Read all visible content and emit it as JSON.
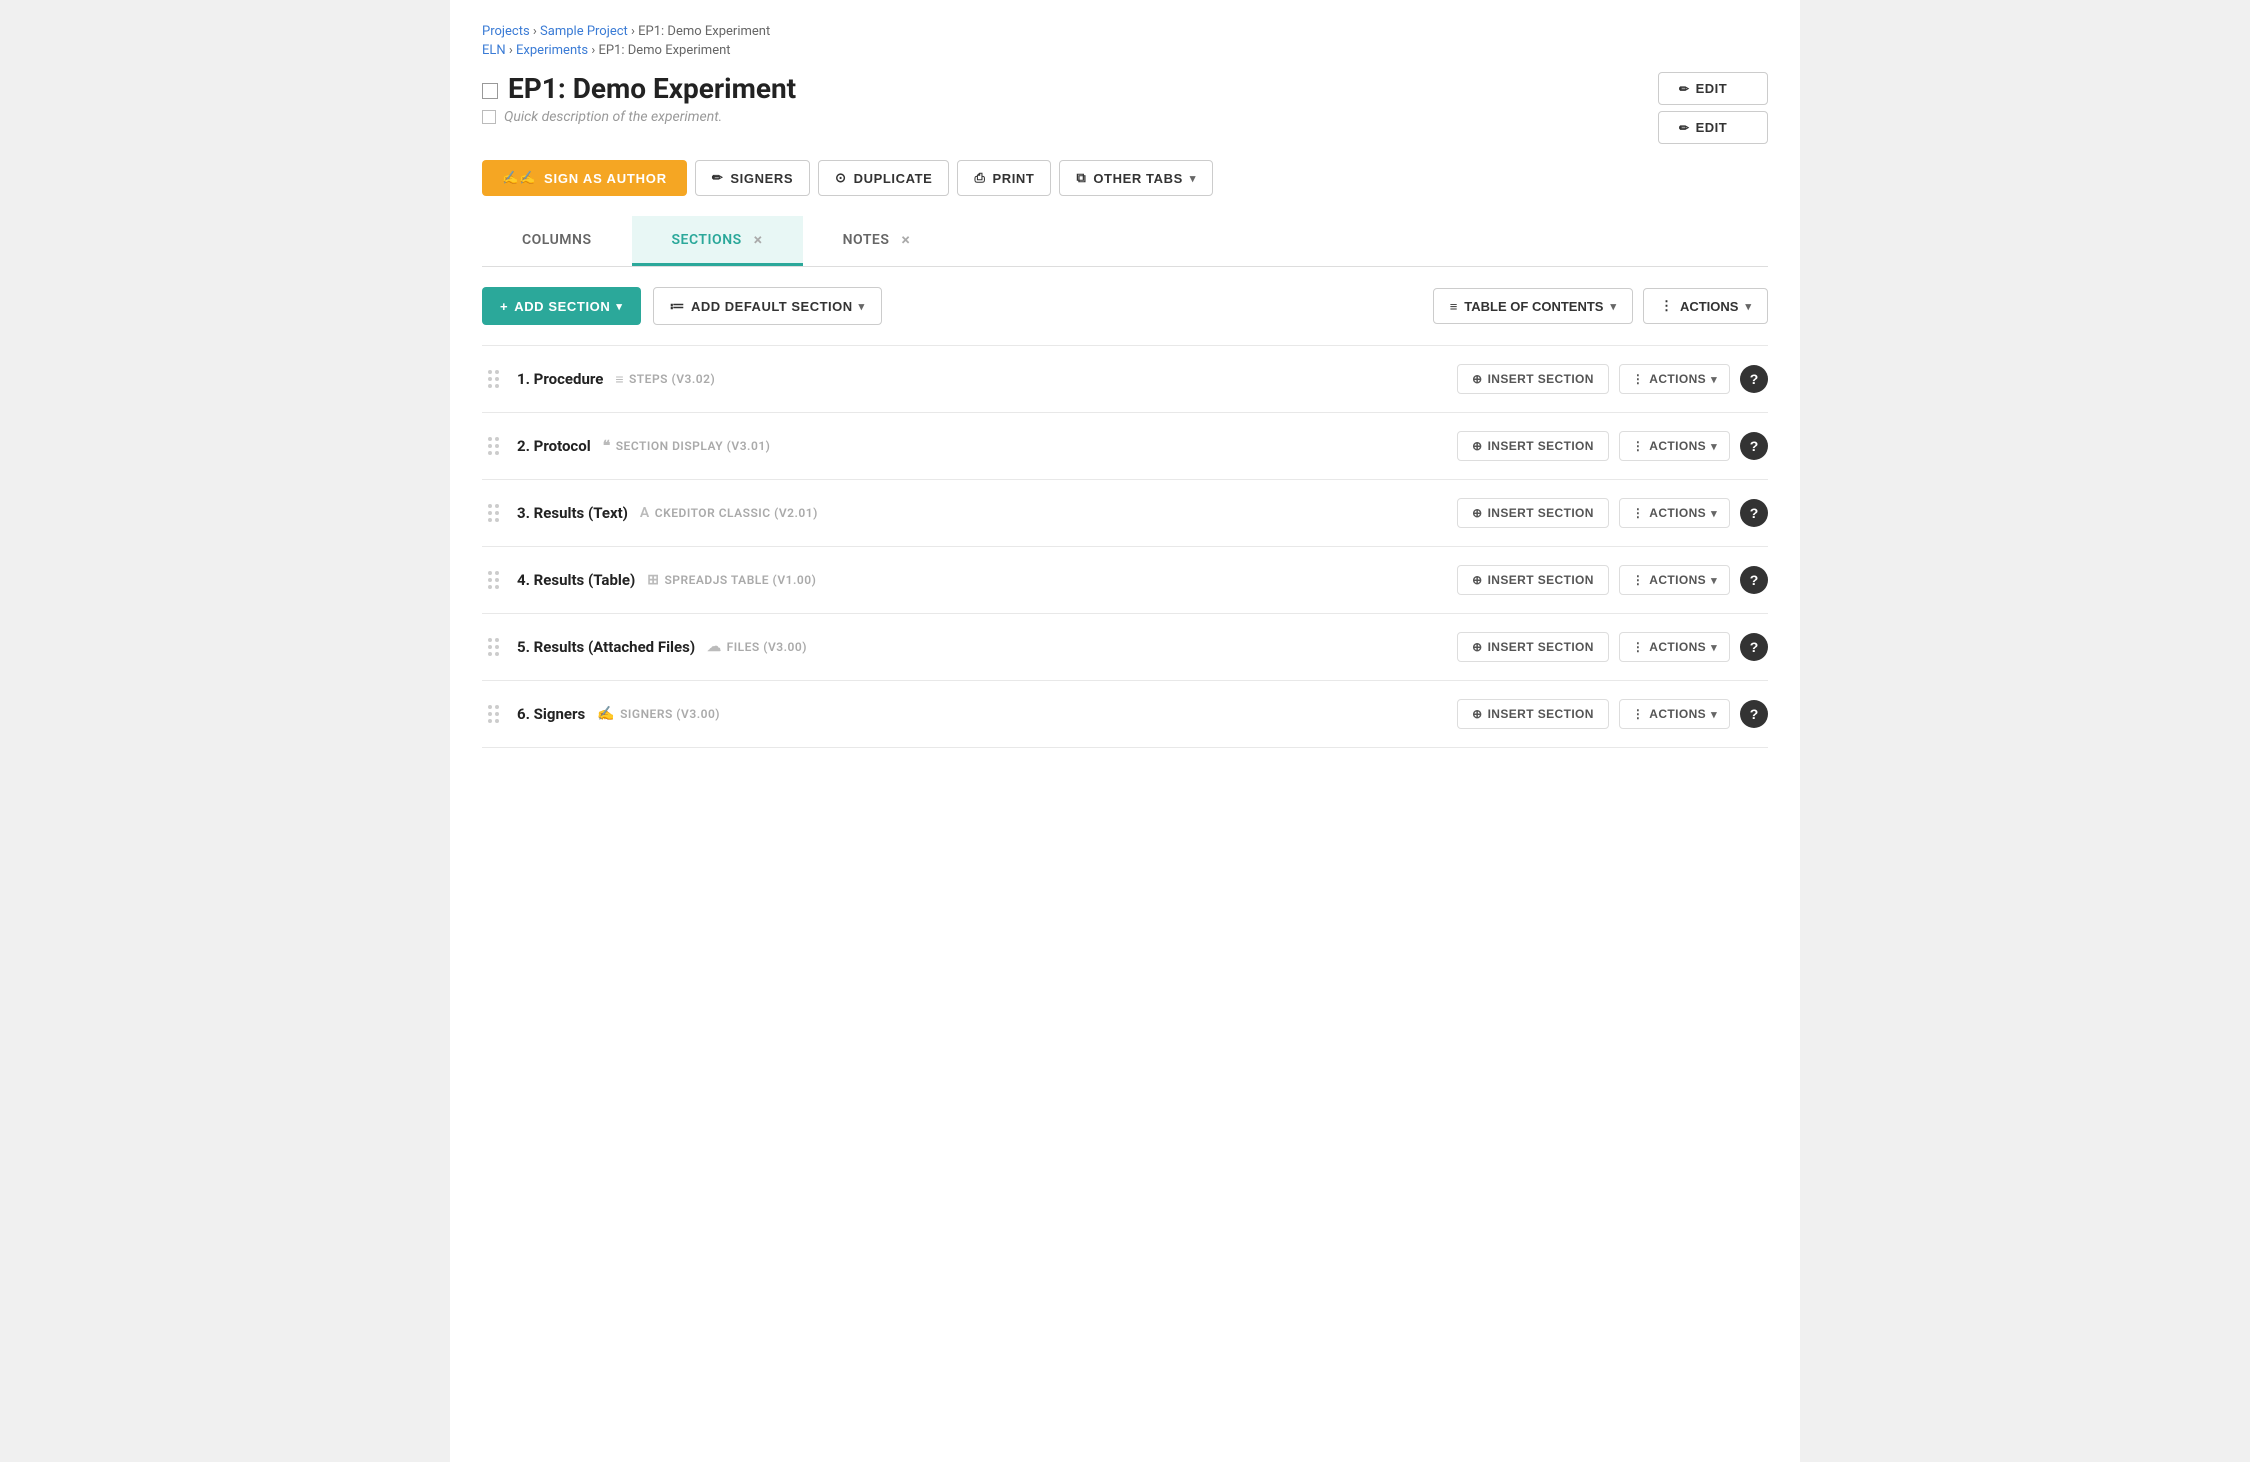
{
  "breadcrumbs": {
    "line1": [
      {
        "label": "Projects",
        "link": true
      },
      {
        "label": " › ",
        "link": false
      },
      {
        "label": "Sample Project",
        "link": true
      },
      {
        "label": " › EP1: Demo Experiment",
        "link": false
      }
    ],
    "line2": [
      {
        "label": "ELN",
        "link": true
      },
      {
        "label": " › ",
        "link": false
      },
      {
        "label": "Experiments",
        "link": true
      },
      {
        "label": " › EP1: Demo Experiment",
        "link": false
      }
    ]
  },
  "page": {
    "title": "EP1: Demo Experiment",
    "description": "Quick description of the experiment."
  },
  "edit_buttons": [
    {
      "label": "EDIT",
      "id": "edit-btn-1"
    },
    {
      "label": "EDIT",
      "id": "edit-btn-2"
    }
  ],
  "toolbar": {
    "sign_author": "SIGN AS AUTHOR",
    "signers": "SIGNERS",
    "duplicate": "DUPLICATE",
    "print": "PRINT",
    "other_tabs": "OTHER TABS"
  },
  "tabs": [
    {
      "label": "COLUMNS",
      "active": false,
      "closeable": false,
      "id": "tab-columns"
    },
    {
      "label": "SECTIONS",
      "active": true,
      "closeable": true,
      "id": "tab-sections"
    },
    {
      "label": "NOTES",
      "active": false,
      "closeable": true,
      "id": "tab-notes"
    }
  ],
  "add_section": {
    "label": "ADD SECTION",
    "default_label": "ADD DEFAULT SECTION",
    "toc_label": "TABLE OF CONTENTS",
    "actions_label": "ACTIONS"
  },
  "sections": [
    {
      "number": "1.",
      "name": "Procedure",
      "type_label": "STEPS (V3.02)",
      "type_icon": "steps"
    },
    {
      "number": "2.",
      "name": "Protocol",
      "type_label": "SECTION DISPLAY (V3.01)",
      "type_icon": "quote"
    },
    {
      "number": "3.",
      "name": "Results (Text)",
      "type_label": "CKEDITOR CLASSIC (V2.01)",
      "type_icon": "text"
    },
    {
      "number": "4.",
      "name": "Results (Table)",
      "type_label": "SPREADJS TABLE (V1.00)",
      "type_icon": "table"
    },
    {
      "number": "5.",
      "name": "Results (Attached Files)",
      "type_label": "FILES (V3.00)",
      "type_icon": "cloud"
    },
    {
      "number": "6.",
      "name": "Signers",
      "type_label": "SIGNERS (V3.00)",
      "type_icon": "signers"
    }
  ],
  "section_row_actions": {
    "insert": "INSERT SECTION",
    "actions": "ACTIONS"
  },
  "colors": {
    "teal": "#2ba89a",
    "orange": "#f5a623",
    "dark": "#333",
    "light_border": "#e8e8e8"
  }
}
